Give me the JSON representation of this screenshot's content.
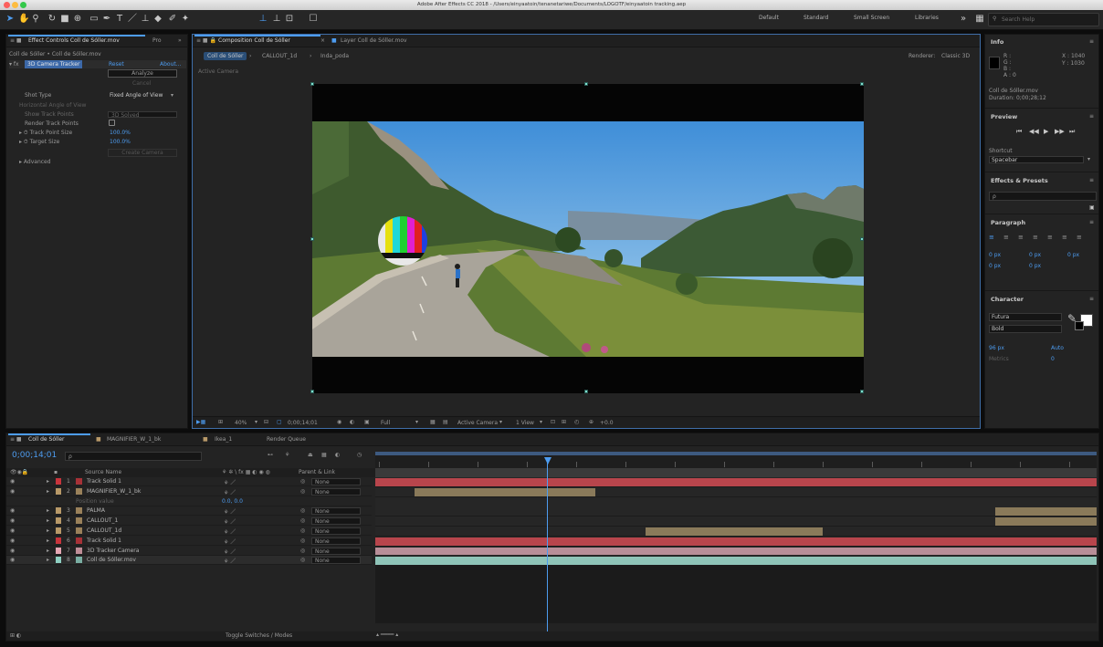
{
  "window": {
    "title": "Adobe After Effects CC 2018 - /Users/einyaatoin/tenanetariwe/Documents/LOGOTF/einyaatoin tracking.aep"
  },
  "toolbar": {
    "workspaces": [
      "Default",
      "Standard",
      "Small Screen",
      "Libraries"
    ],
    "search_placeholder": "Search Help"
  },
  "effect_controls": {
    "tab_label": "Effect Controls Coll de Sóller.mov",
    "tab2_label": "Pro",
    "breadcrumb": "Coll de Sóller • Coll de Sóller.mov",
    "effect_name": "3D Camera Tracker",
    "reset_label": "Reset",
    "about_label": "About...",
    "analyze_label": "Analyze",
    "cancel_label": "Cancel",
    "shot_type_label": "Shot Type",
    "shot_type_value": "Fixed Angle of View",
    "hav_label": "Horizontal Angle of View",
    "show_track_label": "Show Track Points",
    "show_track_value": "3D Solved",
    "render_track_label": "Render Track Points",
    "track_point_size_label": "Track Point Size",
    "track_point_size_value": "100.0%",
    "target_size_label": "Target Size",
    "target_size_value": "100.0%",
    "create_camera_label": "Create Camera",
    "advanced_label": "Advanced"
  },
  "composition": {
    "tab_label": "Composition Coll de Sóller",
    "layer_tab_label": "Layer Coll de Sóller.mov",
    "flow": [
      "Coll de Sóller",
      "CALLOUT_1d",
      "Inda_poda"
    ],
    "renderer_label": "Renderer:",
    "renderer_value": "Classic 3D",
    "active_camera_label": "Active Camera",
    "zoom": "40%",
    "timecode": "0;00;14;01",
    "resolution": "Full",
    "camera_view": "Active Camera",
    "views": "1 View",
    "exposure": "+0.0"
  },
  "info": {
    "title": "Info",
    "r": "R :",
    "g": "G :",
    "b": "B :",
    "a": "A : 0",
    "x": "X : 1040",
    "y": "Y : 1030",
    "filename": "Coll de Sóller.mov",
    "duration": "Duration: 0;00;28;12"
  },
  "preview": {
    "title": "Preview",
    "shortcut_label": "Shortcut",
    "shortcut_value": "Spacebar"
  },
  "effects_presets": {
    "title": "Effects & Presets",
    "search_placeholder": "ρ"
  },
  "paragraph": {
    "title": "Paragraph",
    "v1": "0 px",
    "v2": "0 px",
    "v3": "0 px",
    "v4": "0 px",
    "v5": "0 px"
  },
  "character": {
    "title": "Character",
    "font": "Futura",
    "style": "Bold",
    "size": "96 px",
    "leading": "Auto",
    "tracking": "Metrics",
    "kerning": "0"
  },
  "timeline": {
    "tabs": [
      "Coll de Sóller",
      "MAGNIFIER_W_1_bk",
      "Ikea_1",
      "Render Queue"
    ],
    "timecode": "0;00;14;01",
    "search_placeholder": "ρ",
    "columns": {
      "source": "Source Name",
      "parent": "Parent & Link"
    },
    "layers": [
      {
        "num": "1",
        "name": "Track Solid 1",
        "color": "#c8343c",
        "parent": "None"
      },
      {
        "num": "2",
        "name": "MAGNIFIER_W_1_bk",
        "color": "#b89968",
        "parent": "None"
      },
      {
        "num": "",
        "name": "Position value",
        "color": "",
        "parent": "",
        "sub": true,
        "value": "0.0, 0.0"
      },
      {
        "num": "3",
        "name": "PALMA",
        "color": "#b89968",
        "parent": "None"
      },
      {
        "num": "4",
        "name": "CALLOUT_1",
        "color": "#b89968",
        "parent": "None"
      },
      {
        "num": "5",
        "name": "CALLOUT_1d",
        "color": "#b89968",
        "parent": "None"
      },
      {
        "num": "6",
        "name": "Track Solid 1",
        "color": "#c8343c",
        "parent": "None"
      },
      {
        "num": "7",
        "name": "3D Tracker Camera",
        "color": "#e6a7b4",
        "parent": "None"
      },
      {
        "num": "8",
        "name": "Coll de Sóller.mov",
        "color": "#8fd0c2",
        "parent": "None"
      }
    ],
    "status_left": "Toggle Switches / Modes"
  }
}
